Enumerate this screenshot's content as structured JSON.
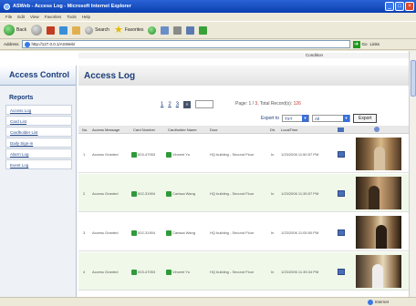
{
  "window": {
    "title": "ASWeb - Access Log - Microsoft Internet Explorer",
    "buttons": [
      "_",
      "□",
      "×"
    ]
  },
  "menu": [
    "File",
    "Edit",
    "View",
    "Favorites",
    "Tools",
    "Help"
  ],
  "toolbar": {
    "back_label": "Back",
    "search_label": "Search",
    "favorites_label": "Favorites"
  },
  "address": {
    "label": "Address",
    "url": "http://127.0.0.1/ASWeb/",
    "go_label": "Go",
    "links_label": "Links"
  },
  "top_strip": {
    "text": "Condition"
  },
  "sidebar": {
    "title": "Access Control",
    "section": "Reports",
    "items": [
      {
        "label": "Access Log"
      },
      {
        "label": "Card List"
      },
      {
        "label": "Cardholder List"
      },
      {
        "label": "Daily Sign-in"
      },
      {
        "label": "Alarm Log"
      },
      {
        "label": "Event Log"
      }
    ]
  },
  "main": {
    "title": "Access Log",
    "pager": {
      "pages": [
        "1",
        "2",
        "3"
      ],
      "next_label": "»",
      "info_prefix": "Page: 1 / ",
      "info_pages": "3",
      "info_mid": ", Total Record(s): ",
      "info_total": "126"
    },
    "export": {
      "label": "Export to",
      "format": "TXT",
      "scope": "All",
      "button": "Export"
    },
    "columns": [
      "No.",
      "Access Message",
      "Card Number",
      "Cardholder Name",
      "Door",
      "Dir.",
      "LocalTime"
    ],
    "rows": [
      {
        "no": "1",
        "message": "Access Granted",
        "card": "003-47053",
        "name": "Vincent Yu",
        "door": "HQ building - Second Floor",
        "dir": "In",
        "time": "1/23/2006 11:50:57 PM"
      },
      {
        "no": "2",
        "message": "Access Granted",
        "card": "002-31904",
        "name": "Carissa Wang",
        "door": "HQ building - Second Floor",
        "dir": "In",
        "time": "1/23/2006 11:35:57 PM"
      },
      {
        "no": "3",
        "message": "Access Granted",
        "card": "002-31904",
        "name": "Carissa Wang",
        "door": "HQ building - Second Floor",
        "dir": "In",
        "time": "1/23/2006 11:05:50 PM"
      },
      {
        "no": "4",
        "message": "Access Granted",
        "card": "003-47053",
        "name": "Vincent Yu",
        "door": "HQ building - Second Floor",
        "dir": "In",
        "time": "1/23/2006 11:35:34 PM"
      }
    ]
  },
  "status": {
    "zone": "Internet"
  },
  "colors": {
    "accent": "#1b3d7a",
    "titlebar": "#0a3fb0",
    "row_alt": "#f0f8ea",
    "badge": "#2f9a3a"
  }
}
